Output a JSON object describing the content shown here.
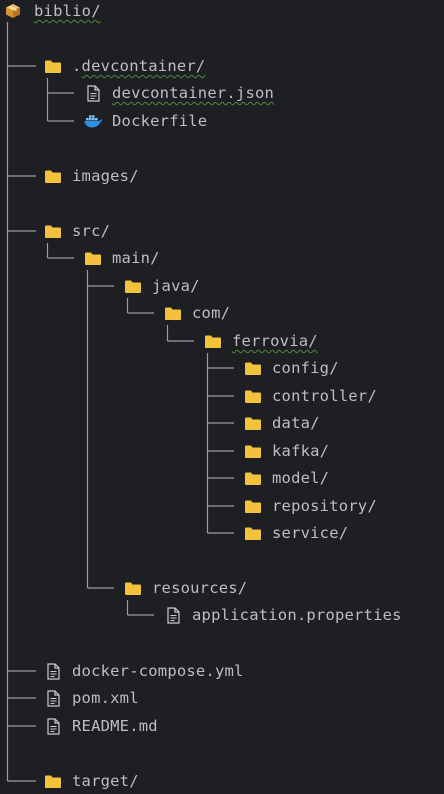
{
  "colors": {
    "background": "#1e1f22",
    "text": "#bcbec4",
    "folder": "#f2c23c",
    "tree_line": "#9a9ca2",
    "spellcheck_underline": "#4e8a3c"
  },
  "tree": {
    "root": {
      "label": "biblio/",
      "icon": "package-icon"
    },
    "devcontainer": {
      "label": ".devcontainer/",
      "icon": "folder-icon"
    },
    "devcontainer_json": {
      "label": "devcontainer.json",
      "icon": "file-icon"
    },
    "dockerfile": {
      "label": "Dockerfile",
      "icon": "docker-icon"
    },
    "images": {
      "label": "images/",
      "icon": "folder-icon"
    },
    "src": {
      "label": "src/",
      "icon": "folder-icon"
    },
    "main": {
      "label": "main/",
      "icon": "folder-icon"
    },
    "java": {
      "label": "java/",
      "icon": "folder-icon"
    },
    "com": {
      "label": "com/",
      "icon": "folder-icon"
    },
    "ferrovia": {
      "label": "ferrovia/",
      "icon": "folder-icon"
    },
    "config": {
      "label": "config/",
      "icon": "folder-icon"
    },
    "controller": {
      "label": "controller/",
      "icon": "folder-icon"
    },
    "data": {
      "label": "data/",
      "icon": "folder-icon"
    },
    "kafka": {
      "label": "kafka/",
      "icon": "folder-icon"
    },
    "model": {
      "label": "model/",
      "icon": "folder-icon"
    },
    "repository": {
      "label": "repository/",
      "icon": "folder-icon"
    },
    "service": {
      "label": "service/",
      "icon": "folder-icon"
    },
    "resources": {
      "label": "resources/",
      "icon": "folder-icon"
    },
    "application_properties": {
      "label": "application.properties",
      "icon": "file-icon"
    },
    "docker_compose": {
      "label": "docker-compose.yml",
      "icon": "file-icon"
    },
    "pom": {
      "label": "pom.xml",
      "icon": "file-icon"
    },
    "readme": {
      "label": "README.md",
      "icon": "file-icon"
    },
    "target": {
      "label": "target/",
      "icon": "folder-icon"
    }
  }
}
